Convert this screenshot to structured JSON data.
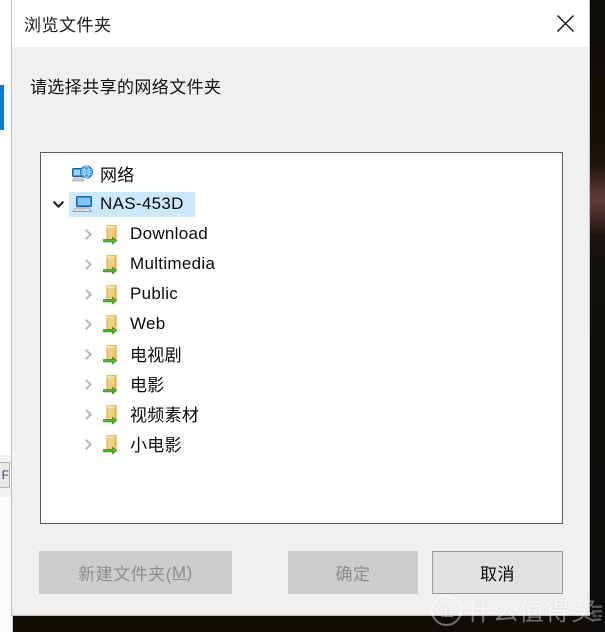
{
  "dialog": {
    "title": "浏览文件夹",
    "close_label": "✕",
    "instruction": "请选择共享的网络文件夹"
  },
  "tree": {
    "root": {
      "label": "网络",
      "icon": "network-globe-icon",
      "expanded": true
    },
    "computer": {
      "label": "NAS-453D",
      "icon": "computer-icon",
      "expanded": true,
      "selected": true
    },
    "folders": [
      {
        "label": "Download",
        "icon": "shared-folder-icon",
        "expanded": false
      },
      {
        "label": "Multimedia",
        "icon": "shared-folder-icon",
        "expanded": false
      },
      {
        "label": "Public",
        "icon": "shared-folder-icon",
        "expanded": false
      },
      {
        "label": "Web",
        "icon": "shared-folder-icon",
        "expanded": false
      },
      {
        "label": "电视剧",
        "icon": "shared-folder-icon",
        "expanded": false
      },
      {
        "label": "电影",
        "icon": "shared-folder-icon",
        "expanded": false
      },
      {
        "label": "视频素材",
        "icon": "shared-folder-icon",
        "expanded": false
      },
      {
        "label": "小电影",
        "icon": "shared-folder-icon",
        "expanded": false
      }
    ]
  },
  "buttons": {
    "new_folder": {
      "text_before": "新建文件夹(",
      "mnemonic": "M",
      "text_after": ")",
      "enabled": false
    },
    "ok": {
      "label": "确定",
      "enabled": false
    },
    "cancel": {
      "label": "取消",
      "enabled": true
    }
  },
  "watermark": {
    "badge": "值",
    "text": "什么值得买"
  },
  "colors": {
    "dialog_body": "#f0f0f0",
    "titlebar": "#ffffff",
    "tree_background": "#ffffff",
    "selection": "#cce8ff",
    "folder_yellow": "#f6d37a",
    "share_green": "#5ab733",
    "button_disabled": "#cccccc",
    "button_enabled": "#e1e1e1",
    "accent_blue": "#1278d4"
  }
}
